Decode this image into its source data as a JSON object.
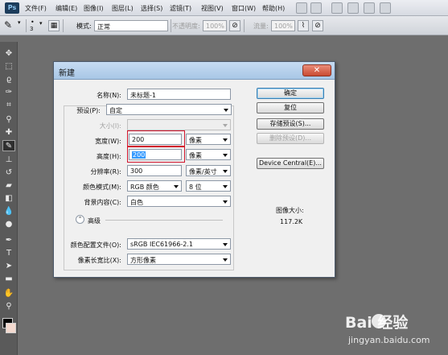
{
  "app": {
    "logo": "Ps"
  },
  "menubar": {
    "items": [
      "文件(F)",
      "编辑(E)",
      "图像(I)",
      "图层(L)",
      "选择(S)",
      "滤镜(T)",
      "视图(V)",
      "窗口(W)",
      "帮助(H)"
    ]
  },
  "options_bar": {
    "brush_size": "3",
    "mode_label": "模式:",
    "mode_value": "正常",
    "opacity_label": "不透明度:",
    "opacity_value": "100%",
    "flow_label": "流量:",
    "flow_value": "100%"
  },
  "toolbar": {
    "tools": [
      "move-tool",
      "marquee-tool",
      "lasso-tool",
      "quick-select-tool",
      "crop-tool",
      "eyedropper-tool",
      "healing-brush-tool",
      "brush-tool",
      "clone-stamp-tool",
      "history-brush-tool",
      "eraser-tool",
      "gradient-tool",
      "blur-tool",
      "dodge-tool",
      "pen-tool",
      "type-tool",
      "path-select-tool",
      "shape-tool",
      "hand-tool",
      "zoom-tool"
    ],
    "active_tool": "brush-tool",
    "foreground_color": "#000000",
    "background_color": "#f3d9cf"
  },
  "dialog": {
    "title": "新建",
    "close_symbol": "✕",
    "fields": {
      "name_label": "名称(N):",
      "name_value": "未标题-1",
      "preset_label": "预设(P):",
      "preset_value": "自定",
      "size_label": "大小(I):",
      "size_value": "",
      "width_label": "宽度(W):",
      "width_value": "200",
      "width_unit": "像素",
      "height_label": "高度(H):",
      "height_value": "200",
      "height_unit": "像素",
      "resolution_label": "分辨率(R):",
      "resolution_value": "300",
      "resolution_unit": "像素/英寸",
      "color_mode_label": "颜色模式(M):",
      "color_mode_value": "RGB 颜色",
      "bit_depth_value": "8 位",
      "background_label": "背景内容(C):",
      "background_value": "白色",
      "advanced_label": "高级",
      "profile_label": "颜色配置文件(O):",
      "profile_value": "sRGB IEC61966-2.1",
      "pixel_aspect_label": "像素长宽比(X):",
      "pixel_aspect_value": "方形像素"
    },
    "buttons": {
      "ok": "确定",
      "reset": "复位",
      "save_preset": "存储预设(S)...",
      "delete_preset": "删除预设(D)...",
      "device_central": "Device Central(E)..."
    },
    "image_size_label": "图像大小:",
    "image_size_value": "117.2K"
  },
  "watermark": {
    "text": "Bai 经验",
    "url": "jingyan.baidu.com"
  },
  "colors": {
    "highlight": "#d0142c",
    "selection": "#3399ff",
    "titlebar": "#b7d1ec"
  }
}
